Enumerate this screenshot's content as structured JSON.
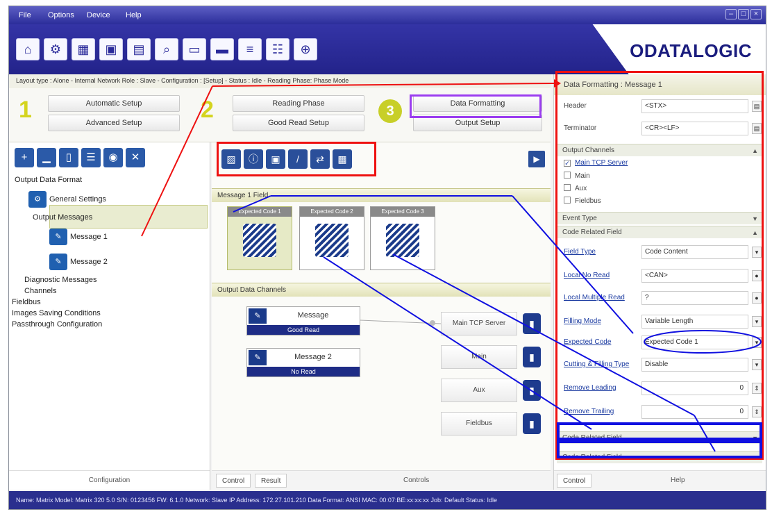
{
  "menu": [
    "File",
    "Options",
    "Device",
    "Help"
  ],
  "window_controls": [
    "–",
    "□",
    "×"
  ],
  "toolbar_icons": [
    "home-icon",
    "settings-icon",
    "device-icon",
    "layout-icon",
    "monitor-icon",
    "scan-icon",
    "image-icon",
    "save-icon",
    "statistics-icon",
    "diagnostics-icon",
    "network-icon"
  ],
  "brand": "ODATALOGIC",
  "status_strip": "Layout type : Alone - Internal Network Role : Slave - Configuration : [Setup] - Status : Idle - Reading Phase: Phase Mode",
  "steps": {
    "n1": "1",
    "n2": "2",
    "n3": "3",
    "automatic_setup": "Automatic Setup",
    "advanced_setup": "Advanced Setup",
    "reading_phase": "Reading Phase",
    "good_read_setup": "Good Read Setup",
    "data_formatting": "Data Formatting",
    "output_setup": "Output Setup"
  },
  "tree": {
    "output_data_format": "Output Data Format",
    "global_settings": "General Settings",
    "output_messages": "Output Messages",
    "message1": "Message 1",
    "message2": "Message 2",
    "diagnostic_messages": "Diagnostic Messages",
    "channels": "Channels",
    "fieldbus": "Fieldbus",
    "image_saving": "Images Saving Conditions",
    "passthrough": "Passthrough Configuration"
  },
  "left_footer": "Configuration",
  "middle": {
    "section1": "Message 1 Field",
    "code1": "Expected Code 1",
    "code2": "Expected Code 2",
    "code3": "Expected Code 3",
    "section2": "Output Data Channels",
    "msg1_name": "Message",
    "msg1_status": "Good Read",
    "msg2_name": "Message 2",
    "msg2_status": "No Read",
    "ch1": "Main TCP Server",
    "ch2": "Main",
    "ch3": "Aux",
    "ch4": "Fieldbus",
    "tab_control": "Control",
    "tab_result": "Result",
    "footer": "Controls"
  },
  "right": {
    "title": "Data Formatting : Message 1",
    "header_label": "Header",
    "header_value": "<STX>",
    "terminator_label": "Terminator",
    "terminator_value": "<CR><LF>",
    "output_channels": "Output Channels",
    "ch_tcp": "Main TCP Server",
    "ch_main": "Main",
    "ch_aux": "Aux",
    "ch_fieldbus": "Fieldbus",
    "event_type": "Event Type",
    "code_related": "Code Related Field",
    "field_type_label": "Field Type",
    "field_type_value": "Code Content",
    "local_no_read_label": "Local No Read",
    "local_no_read_value": "<CAN>",
    "local_multiple_read_label": "Local Multiple Read",
    "local_multiple_read_value": "?",
    "filling_mode_label": "Filling Mode",
    "filling_mode_value": "Variable Length",
    "expected_code_label": "Expected Code",
    "expected_code_value": "Expected Code 1",
    "cutting_filling_label": "Cutting & Filling Type",
    "cutting_filling_value": "Disable",
    "remove_leading_label": "Remove Leading",
    "remove_leading_value": "0",
    "remove_trailing_label": "Remove Trailing",
    "remove_trailing_value": "0",
    "code_related2": "Code Related Field",
    "code_related3": "Code Related Field",
    "footer_left": "Control",
    "footer_right": "Help"
  },
  "statusbar": "Name: Matrix  Model: Matrix 320 5.0  S/N: 0123456  FW: 6.1.0  Network: Slave  IP Address: 172.27.101.210  Data Format: ANSI  MAC: 00:07:BE:xx:xx:xx  Job: Default  Status: Idle",
  "colors": {
    "accent_blue": "#2b2d9a",
    "annotation_red": "#e11111",
    "annotation_blue": "#1010e0",
    "annotation_purple": "#9b3df0",
    "step_yellow": "#d4d41e"
  }
}
